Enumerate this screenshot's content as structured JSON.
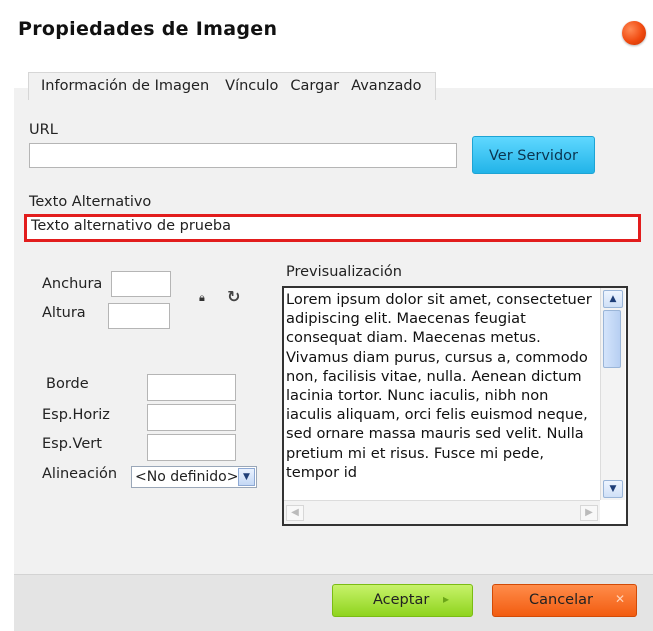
{
  "dialog": {
    "title": "Propiedades de Imagen"
  },
  "tabs": [
    "Información de Imagen",
    "Vínculo",
    "Cargar",
    "Avanzado"
  ],
  "url": {
    "label": "URL",
    "value": "",
    "server_button": "Ver Servidor"
  },
  "alt_text": {
    "label": "Texto Alternativo",
    "value": "Texto alternativo de prueba"
  },
  "dimensions": {
    "width_label": "Anchura",
    "height_label": "Altura",
    "width_value": "",
    "height_value": ""
  },
  "layout": {
    "border_label": "Borde",
    "hspace_label": "Esp.Horiz",
    "vspace_label": "Esp.Vert",
    "align_label": "Alineación",
    "align_selected": "<No definido>"
  },
  "preview": {
    "label": "Previsualización",
    "text": "Lorem ipsum dolor sit amet, consectetuer adipiscing elit. Maecenas feugiat consequat diam. Maecenas metus. Vivamus diam purus, cursus a, commodo non, facilisis vitae, nulla. Aenean dictum lacinia tortor. Nunc iaculis, nibh non iaculis aliquam, orci felis euismod neque, sed ornare massa mauris sed velit. Nulla pretium mi et risus. Fusce mi pede, tempor id"
  },
  "footer": {
    "ok_label": "Aceptar",
    "cancel_label": "Cancelar"
  },
  "colors": {
    "close": "#f04a10",
    "server_button": "#22b4e8",
    "ok_button": "#8fd41e",
    "cancel_button": "#f25c10",
    "highlight": "#e21d1d"
  }
}
